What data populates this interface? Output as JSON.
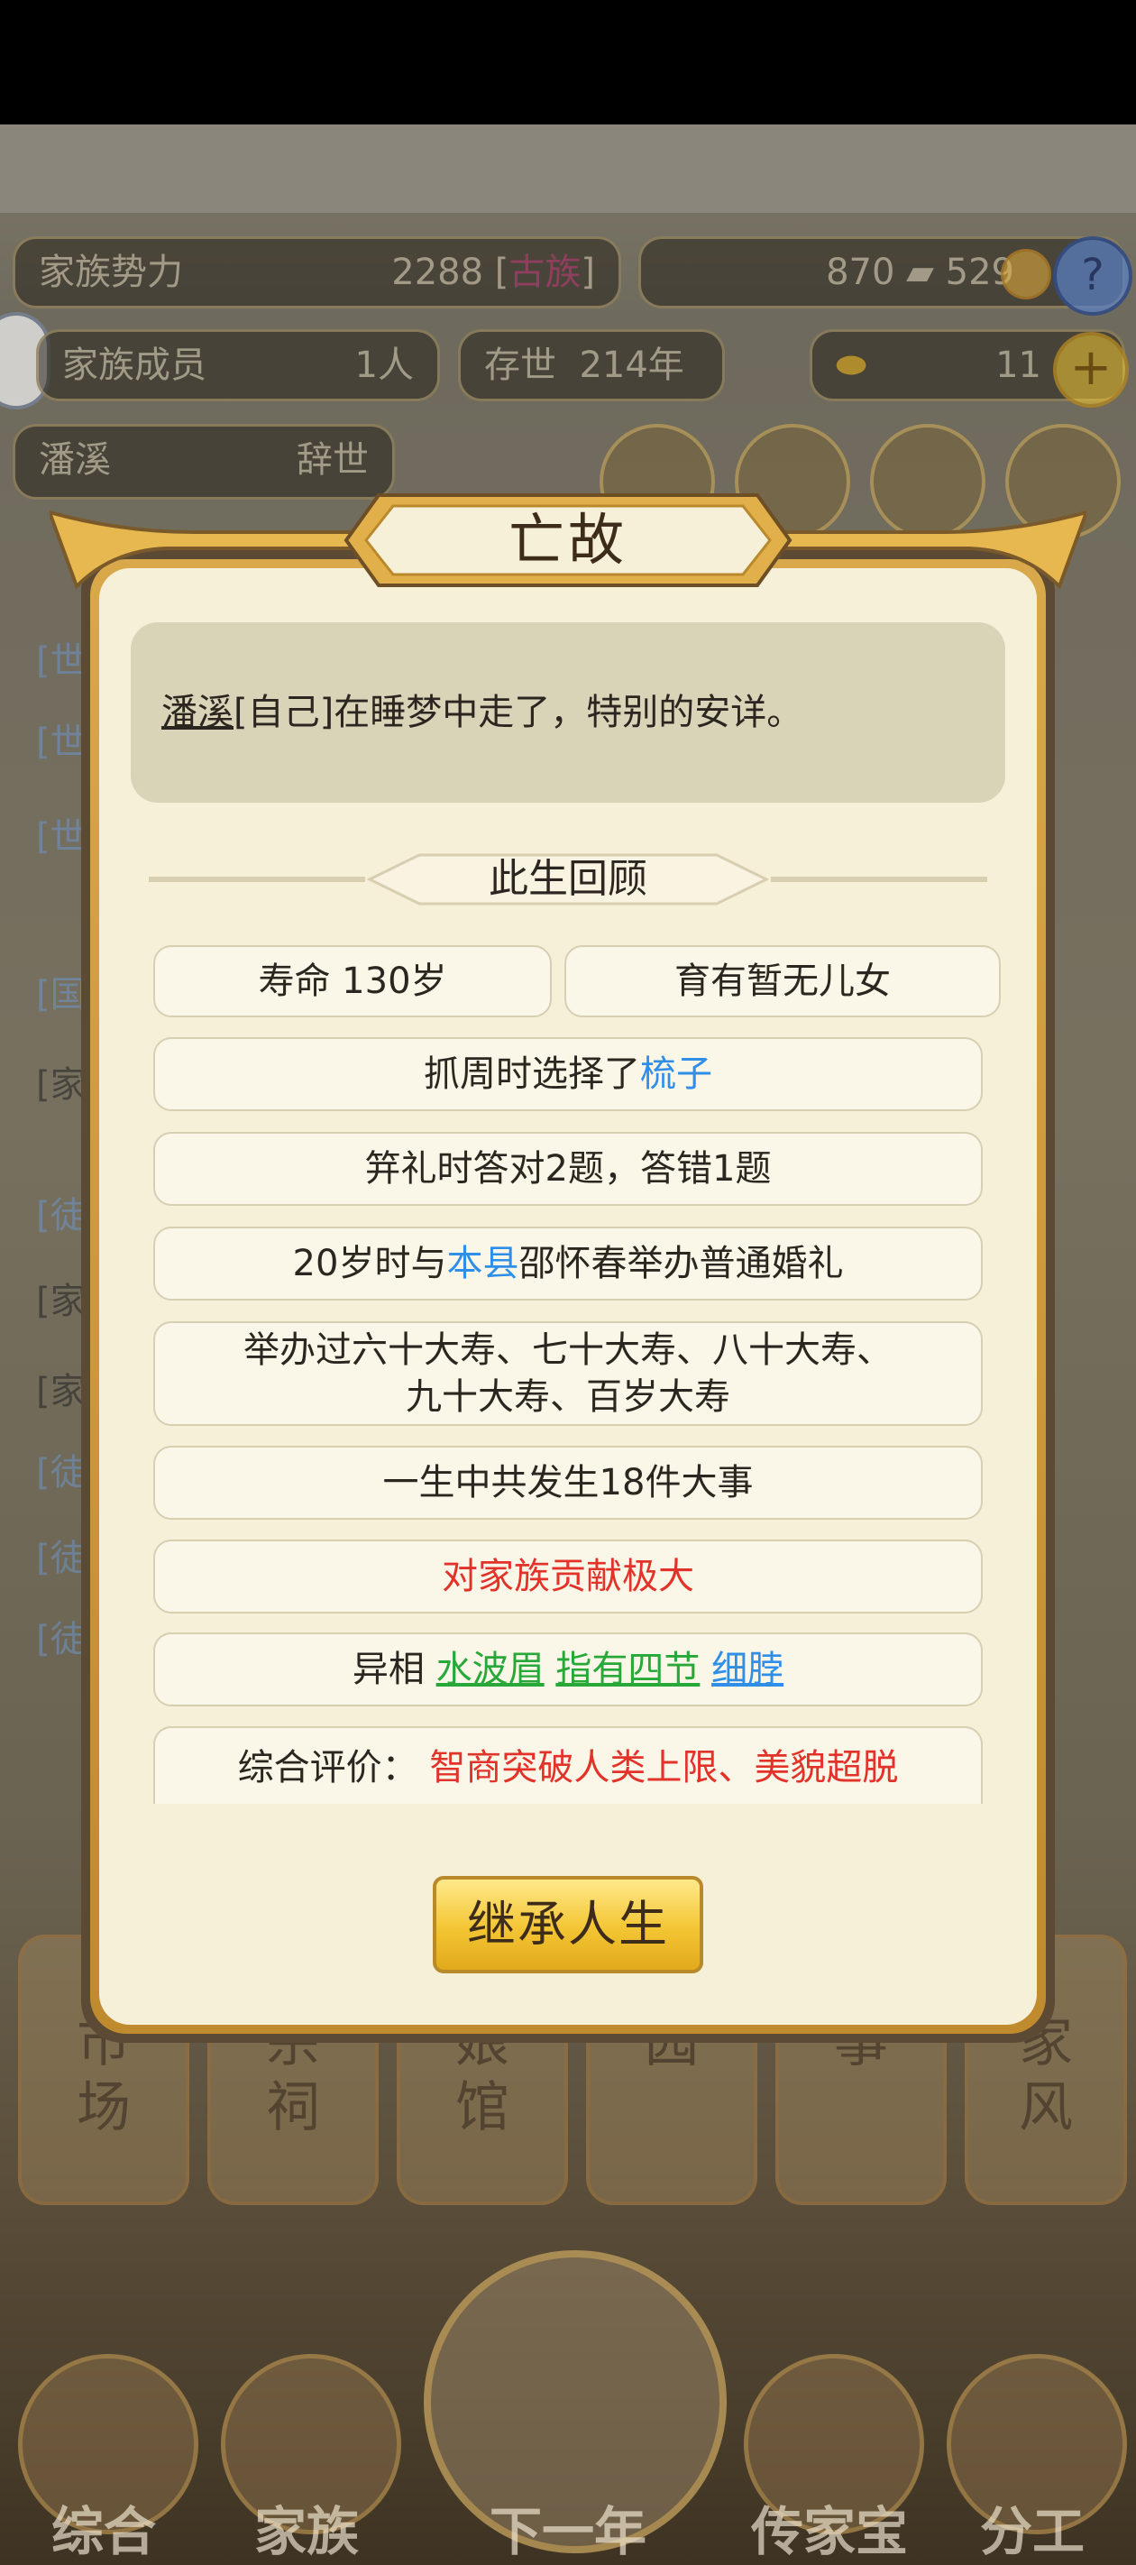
{
  "hud": {
    "power_label": "家族势力",
    "power_value": "2288",
    "power_rank": "古族",
    "silver": "870",
    "gold_coins": "529",
    "help_symbol": "?",
    "members_label": "家族成员",
    "members_value": "1人",
    "exist_label": "存世",
    "exist_value": "214年",
    "ingot_value": "11",
    "add_symbol": "+",
    "person_name": "潘溪",
    "person_status": "辞世"
  },
  "bg_log": [
    "[世",
    "[世",
    "[世",
    "[国",
    "[家",
    "[徒",
    "[家",
    "[家",
    "[徒",
    "[徒",
    "[徒"
  ],
  "tiles": [
    "市\n场",
    "宗\n祠",
    "娘\n馆",
    "园",
    "事",
    "家\n风"
  ],
  "nav": {
    "items": [
      "综合",
      "家族",
      "下一年",
      "传家宝",
      "分工"
    ]
  },
  "modal": {
    "title": "亡故",
    "message": {
      "name": "潘溪",
      "rest": "[自己]在睡梦中走了，特别的安详。"
    },
    "section_title": "此生回顾",
    "lifespan": "寿命 130岁",
    "children": "育有暂无儿女",
    "zhuazhou_prefix": "抓周时选择了",
    "zhuazhou_item": "梳子",
    "jili": "笄礼时答对2题，答错1题",
    "marriage_prefix": "20岁时与",
    "marriage_place": "本县",
    "marriage_suffix": "邵怀春举办普通婚礼",
    "birthday_line1": "举办过六十大寿、七十大寿、八十大寿、",
    "birthday_line2": "九十大寿、百岁大寿",
    "events": "一生中共发生18件大事",
    "contribution": "对家族贡献极大",
    "traits_label": "异相",
    "trait1": "水波眉",
    "trait2": "指有四节",
    "trait3": "细脖",
    "eval_label": "综合评价：",
    "eval_value": "智商突破人类上限、美貌超脱",
    "button": "继承人生"
  },
  "colors": {
    "accent_blue": "#2f8fe8",
    "accent_red": "#e2332a",
    "accent_green": "#28a838",
    "gold": "#f3c533"
  }
}
